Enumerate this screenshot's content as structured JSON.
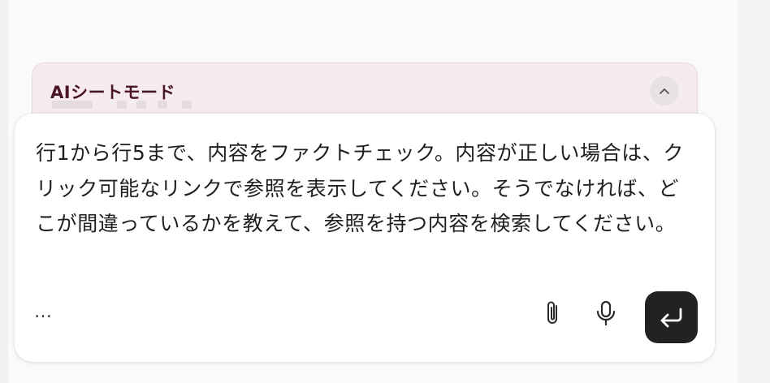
{
  "mode_panel": {
    "title": "AIシートモード",
    "collapse_icon": "chevron-up-icon"
  },
  "prompt": {
    "text": "行1から行5まで、内容をファクトチェック。内容が正しい場合は、クリック可能なリンクで参照を表示してください。そうでなければ、どこが間違っているかを教えて、参照を持つ内容を検索してください。",
    "more_label": "…",
    "attach_icon": "paperclip-icon",
    "mic_icon": "microphone-icon",
    "send_icon": "return-arrow-icon"
  },
  "colors": {
    "mode_title": "#4a1528",
    "mode_background": "#f6eced",
    "send_button": "#222222"
  }
}
